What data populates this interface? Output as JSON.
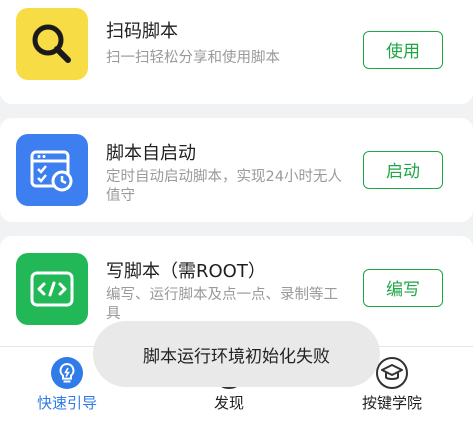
{
  "cards": [
    {
      "title": "扫码脚本",
      "description": "扫一扫轻松分享和使用脚本",
      "button_label": "使用",
      "icon": "magnifier-icon",
      "icon_color": "#f8dc45"
    },
    {
      "title": "脚本自启动",
      "description": "定时自动启动脚本，实现24小时无人值守",
      "button_label": "启动",
      "icon": "calendar-clock-icon",
      "icon_color": "#3d7ef0"
    },
    {
      "title": "写脚本（需ROOT）",
      "description": "编写、运行脚本及点一点、录制等工具",
      "button_label": "编写",
      "icon": "code-icon",
      "icon_color": "#22b858"
    }
  ],
  "bottom_nav": {
    "items": [
      {
        "label": "快速引导",
        "icon": "bulb-icon",
        "active": true
      },
      {
        "label": "发现",
        "icon": "compass-icon",
        "active": false
      },
      {
        "label": "按键学院",
        "icon": "graduation-cap-icon",
        "active": false
      }
    ]
  },
  "toast": {
    "message": "脚本运行环境初始化失败"
  },
  "colors": {
    "accent": "#1fa646",
    "nav_active": "#2f7be8",
    "background": "#f1f2f4"
  }
}
